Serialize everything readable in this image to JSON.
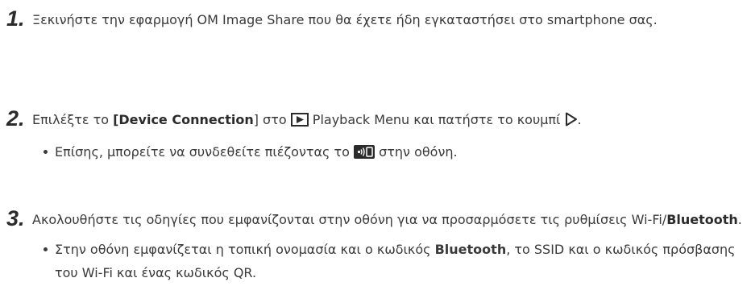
{
  "steps": [
    {
      "number": "1.",
      "text": "Ξεκινήστε την εφαρμογή OM Image Share που θα έχετε ήδη εγκαταστήσει στο smartphone σας."
    },
    {
      "number": "2.",
      "text_before": "Επιλέξτε το ",
      "bold_item": "[Device Connection",
      "bracket_close": "]",
      "text_middle": " στο ",
      "playback_icon": "playback-icon",
      "menu_name": " Playback Menu",
      "text_after": " και πατήστε το κουμπί ",
      "arrow_icon": "right-arrow-button-icon",
      "period": ".",
      "bullet": {
        "text_before": "Επίσης, μπορείτε να συνδεθείτε πιέζοντας το ",
        "icon": "smartphone-connection-icon",
        "text_after": " στην οθόνη."
      }
    },
    {
      "number": "3.",
      "text_before": "Ακολουθήστε τις οδηγίες που εμφανίζονται στην οθόνη για να προσαρμόσετε τις ρυθμίσεις Wi-Fi/",
      "bold_word": "Bluetooth",
      "period": ".",
      "bullet": {
        "text_before": "Στην οθόνη εμφανίζεται η τοπική ονομασία και ο κωδικός ",
        "bold_word": "Bluetooth",
        "text_after": ", το SSID και ο κωδικός πρόσβασης του Wi-Fi και ένας κωδικός QR."
      }
    }
  ]
}
